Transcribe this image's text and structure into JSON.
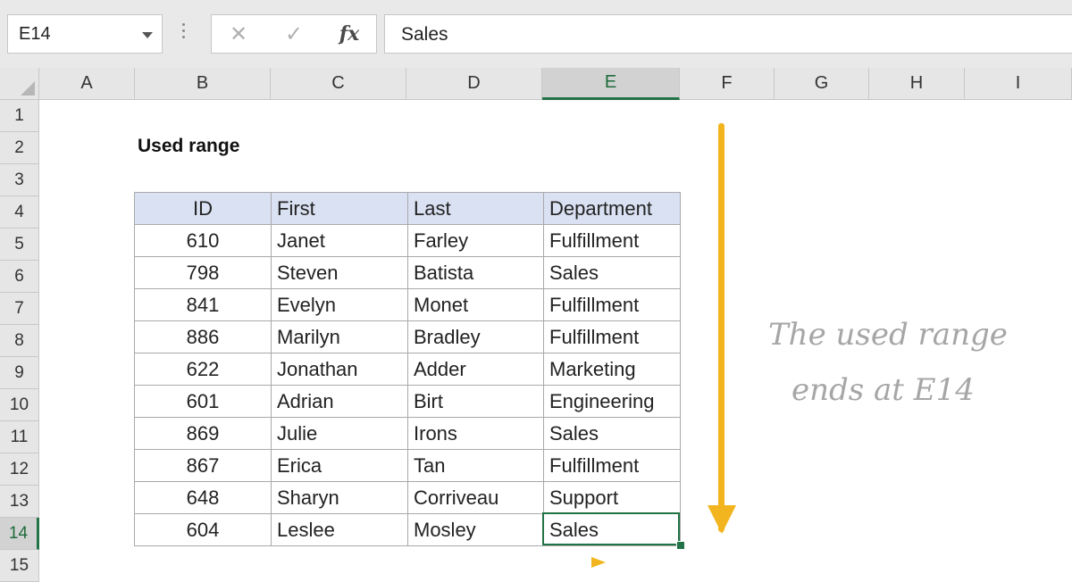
{
  "formula_bar": {
    "name_box": "E14",
    "cancel_glyph": "✕",
    "enter_glyph": "✓",
    "fx_label": "fx",
    "formula": "Sales"
  },
  "columns": [
    "A",
    "B",
    "C",
    "D",
    "E",
    "F",
    "G",
    "H",
    "I"
  ],
  "rows": [
    "1",
    "2",
    "3",
    "4",
    "5",
    "6",
    "7",
    "8",
    "9",
    "10",
    "11",
    "12",
    "13",
    "14",
    "15"
  ],
  "selected_column": "E",
  "selected_row": "14",
  "sheet_title": "Used range",
  "table": {
    "headers": [
      "ID",
      "First",
      "Last",
      "Department"
    ],
    "rows": [
      [
        "610",
        "Janet",
        "Farley",
        "Fulfillment"
      ],
      [
        "798",
        "Steven",
        "Batista",
        "Sales"
      ],
      [
        "841",
        "Evelyn",
        "Monet",
        "Fulfillment"
      ],
      [
        "886",
        "Marilyn",
        "Bradley",
        "Fulfillment"
      ],
      [
        "622",
        "Jonathan",
        "Adder",
        "Marketing"
      ],
      [
        "601",
        "Adrian",
        "Birt",
        "Engineering"
      ],
      [
        "869",
        "Julie",
        "Irons",
        "Sales"
      ],
      [
        "867",
        "Erica",
        "Tan",
        "Fulfillment"
      ],
      [
        "648",
        "Sharyn",
        "Corriveau",
        "Support"
      ],
      [
        "604",
        "Leslee",
        "Mosley",
        "Sales"
      ]
    ]
  },
  "annotation": {
    "line1": "The used range",
    "line2": "ends at E14"
  },
  "colors": {
    "accent": "#217346",
    "header_fill": "#d9e1f2",
    "arrow": "#f2b51f",
    "annotation_text": "#a6a6a6"
  }
}
